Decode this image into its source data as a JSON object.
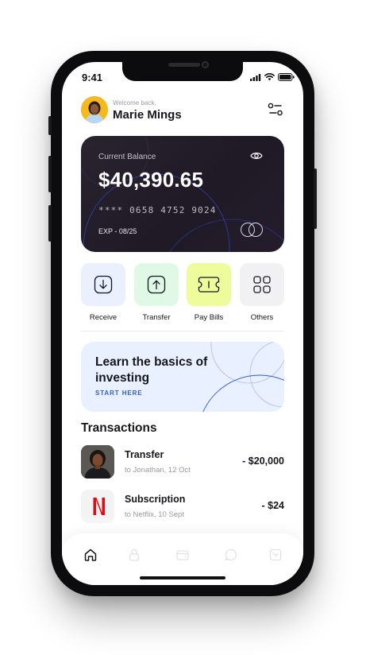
{
  "status_bar": {
    "time": "9:41"
  },
  "header": {
    "welcome": "Welcome back,",
    "user_name": "Marie Mings"
  },
  "card": {
    "label": "Current Balance",
    "balance": "$40,390.65",
    "number": "**** 0658 4752 9024",
    "expiry": "EXP - 08/25"
  },
  "actions": [
    {
      "label": "Receive",
      "icon": "arrow-down-icon",
      "color": "#ebf0ff"
    },
    {
      "label": "Transfer",
      "icon": "arrow-up-icon",
      "color": "#dff9e6"
    },
    {
      "label": "Pay Bills",
      "icon": "ticket-icon",
      "color": "#eefc9b"
    },
    {
      "label": "Others",
      "icon": "grid-icon",
      "color": "#f1f1f3"
    }
  ],
  "promo": {
    "title": "Learn the basics of investing",
    "cta": "START HERE"
  },
  "transactions": {
    "title": "Transactions",
    "items": [
      {
        "title": "Transfer",
        "subtitle": "to Jonathan, 12 Oct",
        "amount": "- $20,000",
        "icon": "person-photo"
      },
      {
        "title": "Subscription",
        "subtitle": "to Netflix, 10 Sept",
        "amount": "- $24",
        "icon": "netflix-logo"
      }
    ]
  },
  "tabbar": {
    "items": [
      {
        "icon": "home-icon",
        "active": true
      },
      {
        "icon": "lock-icon",
        "active": false
      },
      {
        "icon": "wallet-icon",
        "active": false
      },
      {
        "icon": "chat-icon",
        "active": false
      },
      {
        "icon": "chart-icon",
        "active": false
      }
    ]
  },
  "colors": {
    "card_bg": "#231c29",
    "accent_blue": "#2f5bd8",
    "promo_bg": "#e9f0ff",
    "avatar_bg": "#f5b91d",
    "netflix_red": "#e50914"
  }
}
